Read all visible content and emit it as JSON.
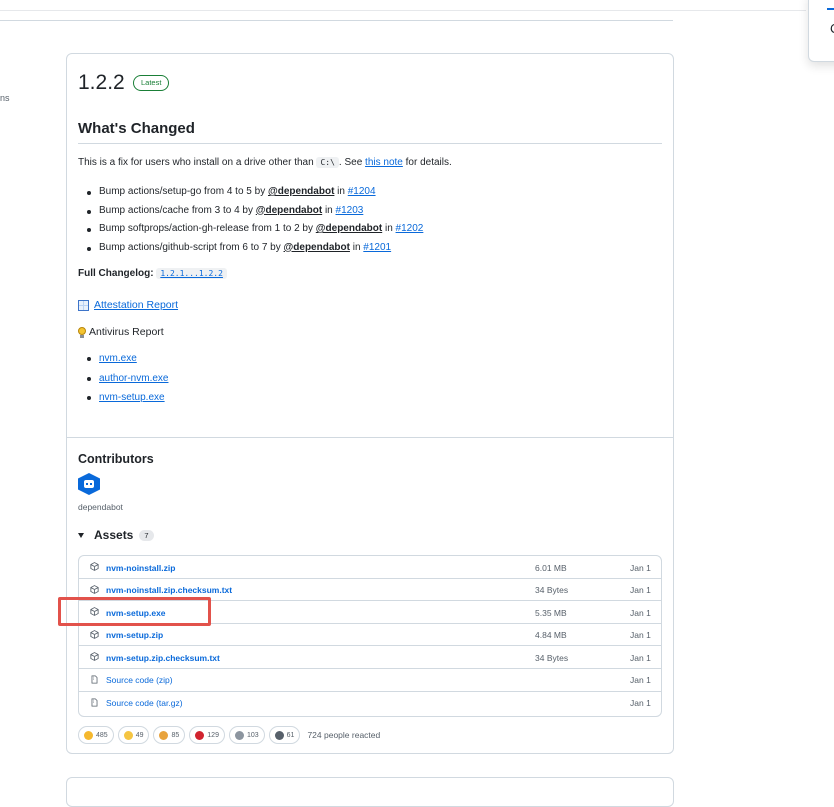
{
  "sidebar_partial_text": "ns",
  "popover_partial_text": "C",
  "release": {
    "version": "1.2.2",
    "badge": "Latest",
    "heading": "What's Changed",
    "intro": {
      "before": "This is a fix for users who install on a drive other than ",
      "code": "C:\\",
      "middle": ". See ",
      "link": "this note",
      "after": " for details."
    },
    "changes": [
      {
        "text": "Bump actions/setup-go from 4 to 5 by ",
        "author": "@dependabot",
        "in": " in ",
        "pr": "#1204"
      },
      {
        "text": "Bump actions/cache from 3 to 4 by ",
        "author": "@dependabot",
        "in": " in ",
        "pr": "#1203"
      },
      {
        "text": "Bump softprops/action-gh-release from 1 to 2 by ",
        "author": "@dependabot",
        "in": " in ",
        "pr": "#1202"
      },
      {
        "text": "Bump actions/github-script from 6 to 7 by ",
        "author": "@dependabot",
        "in": " in ",
        "pr": "#1201"
      }
    ],
    "changelog_label": "Full Changelog:",
    "changelog_link": "1.2.1...1.2.2",
    "attestation": "Attestation Report",
    "antivirus": "Antivirus Report",
    "exe_links": [
      "nvm.exe",
      "author-nvm.exe",
      "nvm-setup.exe"
    ]
  },
  "contributors": {
    "heading": "Contributors",
    "names": [
      "dependabot"
    ]
  },
  "assets": {
    "label": "Assets",
    "count": "7",
    "rows": [
      {
        "name": "nvm-noinstall.zip",
        "size": "6.01 MB",
        "date": "Jan 1",
        "icon": "package-icon"
      },
      {
        "name": "nvm-noinstall.zip.checksum.txt",
        "size": "34 Bytes",
        "date": "Jan 1",
        "icon": "package-icon"
      },
      {
        "name": "nvm-setup.exe",
        "size": "5.35 MB",
        "date": "Jan 1",
        "icon": "package-icon"
      },
      {
        "name": "nvm-setup.zip",
        "size": "4.84 MB",
        "date": "Jan 1",
        "icon": "package-icon"
      },
      {
        "name": "nvm-setup.zip.checksum.txt",
        "size": "34 Bytes",
        "date": "Jan 1",
        "icon": "package-icon"
      },
      {
        "name": "Source code (zip)",
        "size": "",
        "date": "Jan 1",
        "icon": "file-zip-icon"
      },
      {
        "name": "Source code (tar.gz)",
        "size": "",
        "date": "Jan 1",
        "icon": "file-zip-icon"
      }
    ]
  },
  "reactions": {
    "items": [
      {
        "emoji": "thumbs-up-icon",
        "count": "485",
        "color": "#f5b82e"
      },
      {
        "emoji": "laugh-icon",
        "count": "49",
        "color": "#f5c542"
      },
      {
        "emoji": "hooray-icon",
        "count": "85",
        "color": "#e8a33d"
      },
      {
        "emoji": "heart-icon",
        "count": "129",
        "color": "#d1242f"
      },
      {
        "emoji": "rocket-icon",
        "count": "103",
        "color": "#8c959f"
      },
      {
        "emoji": "eyes-icon",
        "count": "61",
        "color": "#57606a"
      }
    ],
    "summary": "724 people reacted"
  },
  "highlight_color": "#e2524b"
}
